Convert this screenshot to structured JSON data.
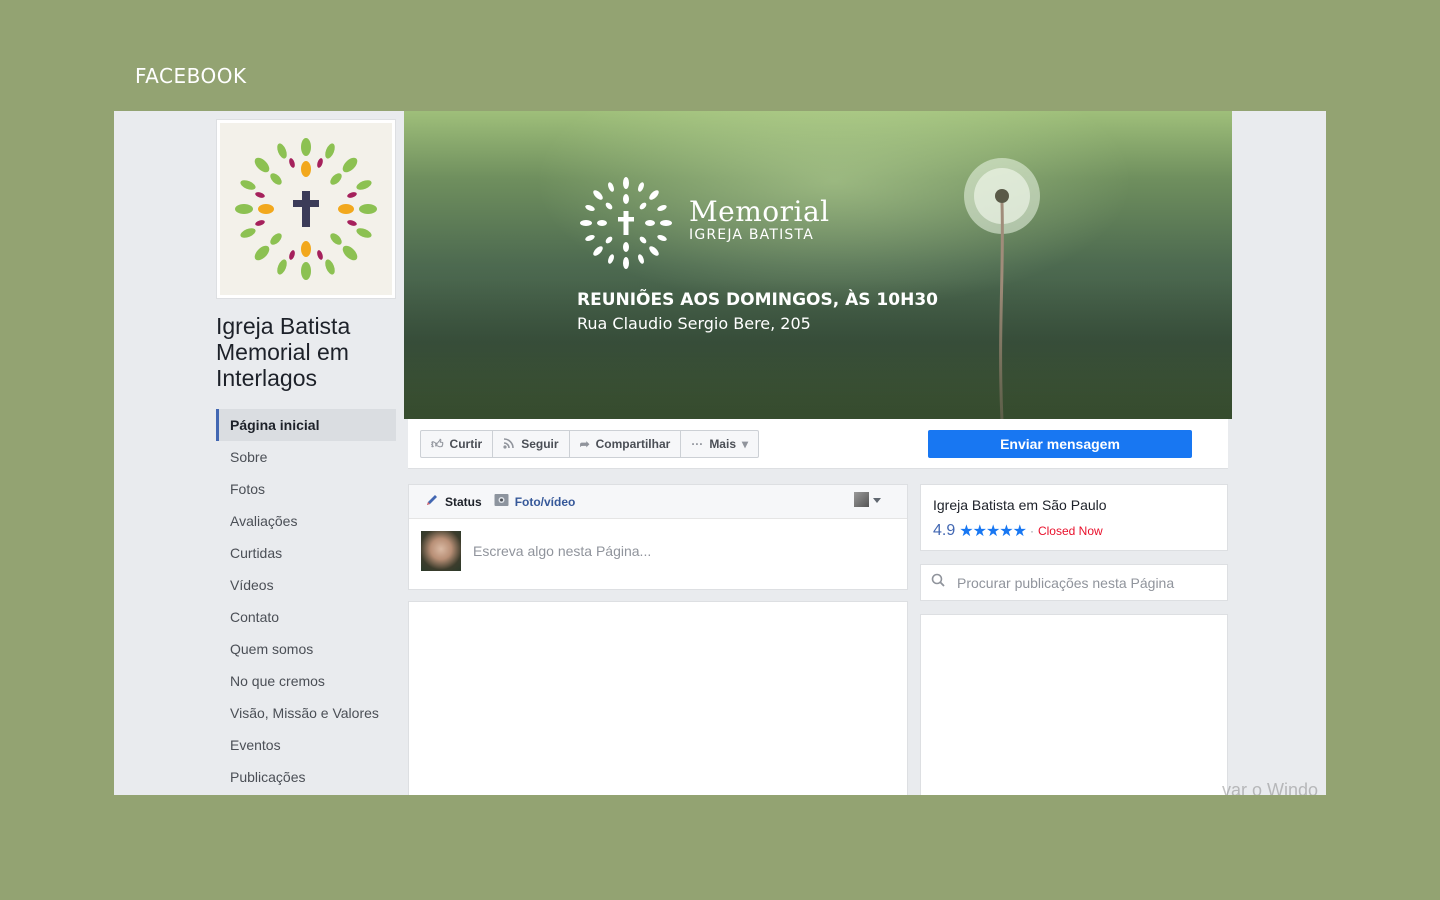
{
  "section_title": "FACEBOOK",
  "page": {
    "name": "Igreja Batista Memorial em Interlagos"
  },
  "nav": {
    "items": [
      {
        "label": "Página inicial"
      },
      {
        "label": "Sobre"
      },
      {
        "label": "Fotos"
      },
      {
        "label": "Avaliações"
      },
      {
        "label": "Curtidas"
      },
      {
        "label": "Vídeos"
      },
      {
        "label": "Contato"
      },
      {
        "label": "Quem somos"
      },
      {
        "label": "No que cremos"
      },
      {
        "label": "Visão, Missão e Valores"
      },
      {
        "label": "Eventos"
      },
      {
        "label": "Publicações"
      }
    ],
    "active": "Página inicial"
  },
  "cover": {
    "brand": "Memorial",
    "brand_sub": "IGREJA BATISTA",
    "headline": "REUNIÕES AOS DOMINGOS, ÀS 10H30",
    "address": "Rua Claudio Sergio Bere, 205"
  },
  "actions": {
    "like": "Curtir",
    "follow": "Seguir",
    "share": "Compartilhar",
    "more": "Mais",
    "send_message": "Enviar mensagem"
  },
  "composer": {
    "tab_status": "Status",
    "tab_photo": "Foto/vídeo",
    "placeholder": "Escreva algo nesta Página..."
  },
  "info": {
    "title": "Igreja Batista em São Paulo",
    "rating": "4.9",
    "stars": "★★★★★",
    "separator": "·",
    "status": "Closed Now"
  },
  "search": {
    "placeholder": "Procurar publicações nesta Página"
  },
  "watermark": "var o Windo",
  "colors": {
    "background": "#93a372",
    "facebook_blue": "#1877f2",
    "closed_red": "#e9102b",
    "nav_active_border": "#4267b2"
  }
}
